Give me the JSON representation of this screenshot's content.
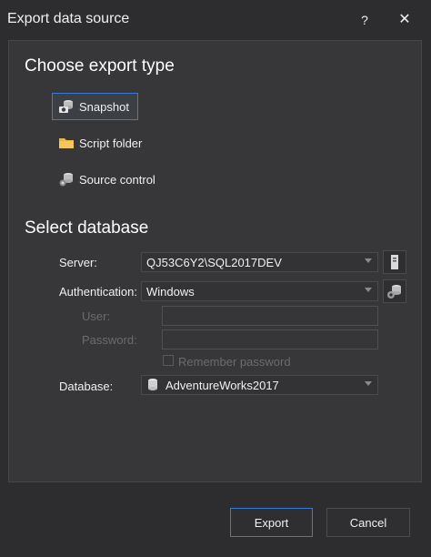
{
  "window": {
    "title": "Export data source",
    "help_label": "?",
    "close_label": "✕"
  },
  "export_type": {
    "heading": "Choose export type",
    "options": [
      {
        "label": "Snapshot",
        "icon": "camera-database-icon",
        "selected": true
      },
      {
        "label": "Script folder",
        "icon": "folder-icon",
        "selected": false
      },
      {
        "label": "Source control",
        "icon": "source-control-database-icon",
        "selected": false
      }
    ]
  },
  "database_section": {
    "heading": "Select database",
    "server_label": "Server:",
    "server_value": "QJ53C6Y2\\SQL2017DEV",
    "auth_label": "Authentication:",
    "auth_value": "Windows",
    "user_label": "User:",
    "user_value": "",
    "password_label": "Password:",
    "password_value": "",
    "remember_label": "Remember password",
    "database_label": "Database:",
    "database_value": "AdventureWorks2017"
  },
  "buttons": {
    "export": "Export",
    "cancel": "Cancel"
  },
  "colors": {
    "background": "#2d2d30",
    "panel": "#373739",
    "accent": "#3a7bd5"
  }
}
